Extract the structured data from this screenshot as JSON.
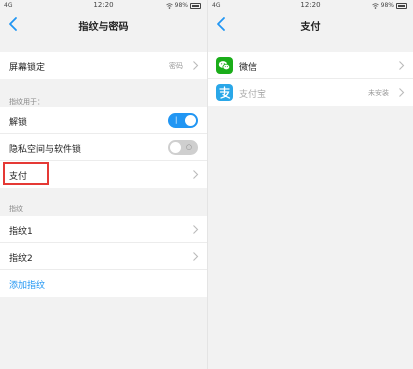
{
  "left": {
    "status": {
      "network": "4G",
      "time": "12:20",
      "battery": "98%"
    },
    "title": "指纹与密码",
    "screen_lock": {
      "label": "屏幕锁定",
      "value": "密码"
    },
    "fingerprint_use_header": "指纹用于：",
    "unlock": {
      "label": "解锁",
      "enabled": true
    },
    "privacy": {
      "label": "隐私空间与软件锁",
      "enabled": false
    },
    "payment": {
      "label": "支付"
    },
    "fingerprints_header": "指纹",
    "fingerprints": [
      "指纹1",
      "指纹2"
    ],
    "add_fingerprint": "添加指纹"
  },
  "right": {
    "status": {
      "network": "4G",
      "time": "12:20",
      "battery": "98%"
    },
    "title": "支付",
    "apps": [
      {
        "name": "微信",
        "status": "",
        "color": "#1aad19"
      },
      {
        "name": "支付宝",
        "status": "未安装",
        "color": "#2aa7e8"
      }
    ]
  },
  "colors": {
    "accent": "#2196f3",
    "highlight": "#e53935"
  }
}
